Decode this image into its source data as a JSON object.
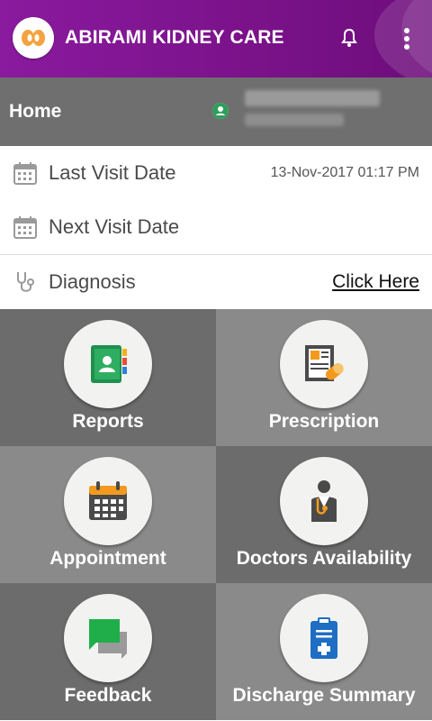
{
  "app": {
    "title": "ABIRAMI KIDNEY CARE"
  },
  "home": {
    "title": "Home"
  },
  "visit": {
    "last_label": "Last Visit Date",
    "last_value": "13-Nov-2017 01:17 PM",
    "next_label": "Next Visit Date",
    "next_value": "",
    "diagnosis_label": "Diagnosis",
    "diagnosis_link": "Click Here"
  },
  "tiles": [
    {
      "label": "Reports",
      "icon": "contact-book-icon"
    },
    {
      "label": "Prescription",
      "icon": "prescription-icon"
    },
    {
      "label": "Appointment",
      "icon": "calendar-icon"
    },
    {
      "label": "Doctors Availability",
      "icon": "doctor-icon"
    },
    {
      "label": "Feedback",
      "icon": "chat-icon"
    },
    {
      "label": "Discharge Summary",
      "icon": "clipboard-icon"
    }
  ],
  "colors": {
    "appbar": "#7a1289",
    "homebar": "#6f6f6f",
    "tile_dark": "#6c6c6c",
    "tile_light": "#8a8a8a"
  }
}
